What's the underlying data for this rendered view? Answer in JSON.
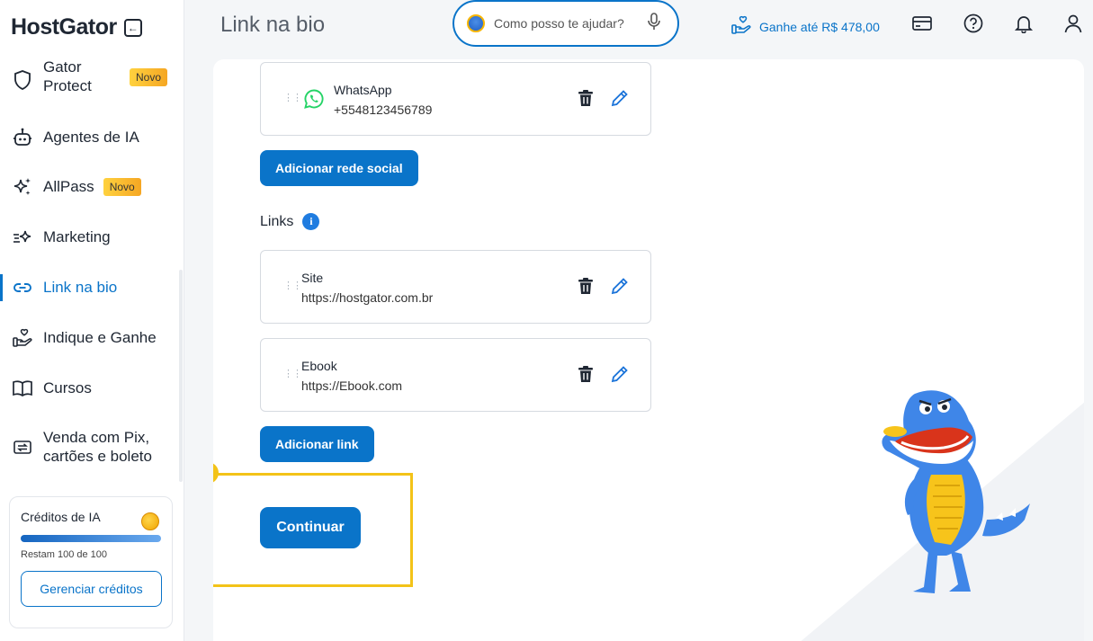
{
  "sidebar": {
    "logo": "HostGator",
    "items": [
      {
        "label": "Gator Protect",
        "badge": "Novo",
        "icon": "shield-icon"
      },
      {
        "label": "Agentes de IA",
        "icon": "robot-icon"
      },
      {
        "label": "AllPass",
        "badge": "Novo",
        "icon": "sparkles-icon"
      },
      {
        "label": "Marketing",
        "icon": "marketing-sparkle-icon"
      },
      {
        "label": "Link na bio",
        "icon": "link-icon",
        "active": true
      },
      {
        "label": "Indique e Ganhe",
        "icon": "hand-heart-icon"
      },
      {
        "label": "Cursos",
        "icon": "book-icon"
      },
      {
        "label": "Venda com Pix, cartões e boleto",
        "icon": "exchange-icon"
      }
    ],
    "credits": {
      "title": "Créditos de IA",
      "remaining": "Restam 100 de 100",
      "remaining_fraction": 1.0,
      "manage_label": "Gerenciar créditos"
    }
  },
  "header": {
    "title": "Link na bio",
    "search_placeholder": "Como posso te ajudar?",
    "earn_label": "Ganhe até R$ 478,00"
  },
  "social": {
    "items": [
      {
        "title": "WhatsApp",
        "value": "+5548123456789"
      }
    ],
    "add_label": "Adicionar rede social"
  },
  "links": {
    "label": "Links",
    "items": [
      {
        "title": "Site",
        "url": "https://hostgator.com.br"
      },
      {
        "title": "Ebook",
        "url": "https://Ebook.com"
      }
    ],
    "add_label": "Adicionar link"
  },
  "step_number": "6",
  "continue_label": "Continuar",
  "colors": {
    "primary": "#0a74c9",
    "highlight": "#f3c318",
    "whatsapp": "#25d366"
  }
}
